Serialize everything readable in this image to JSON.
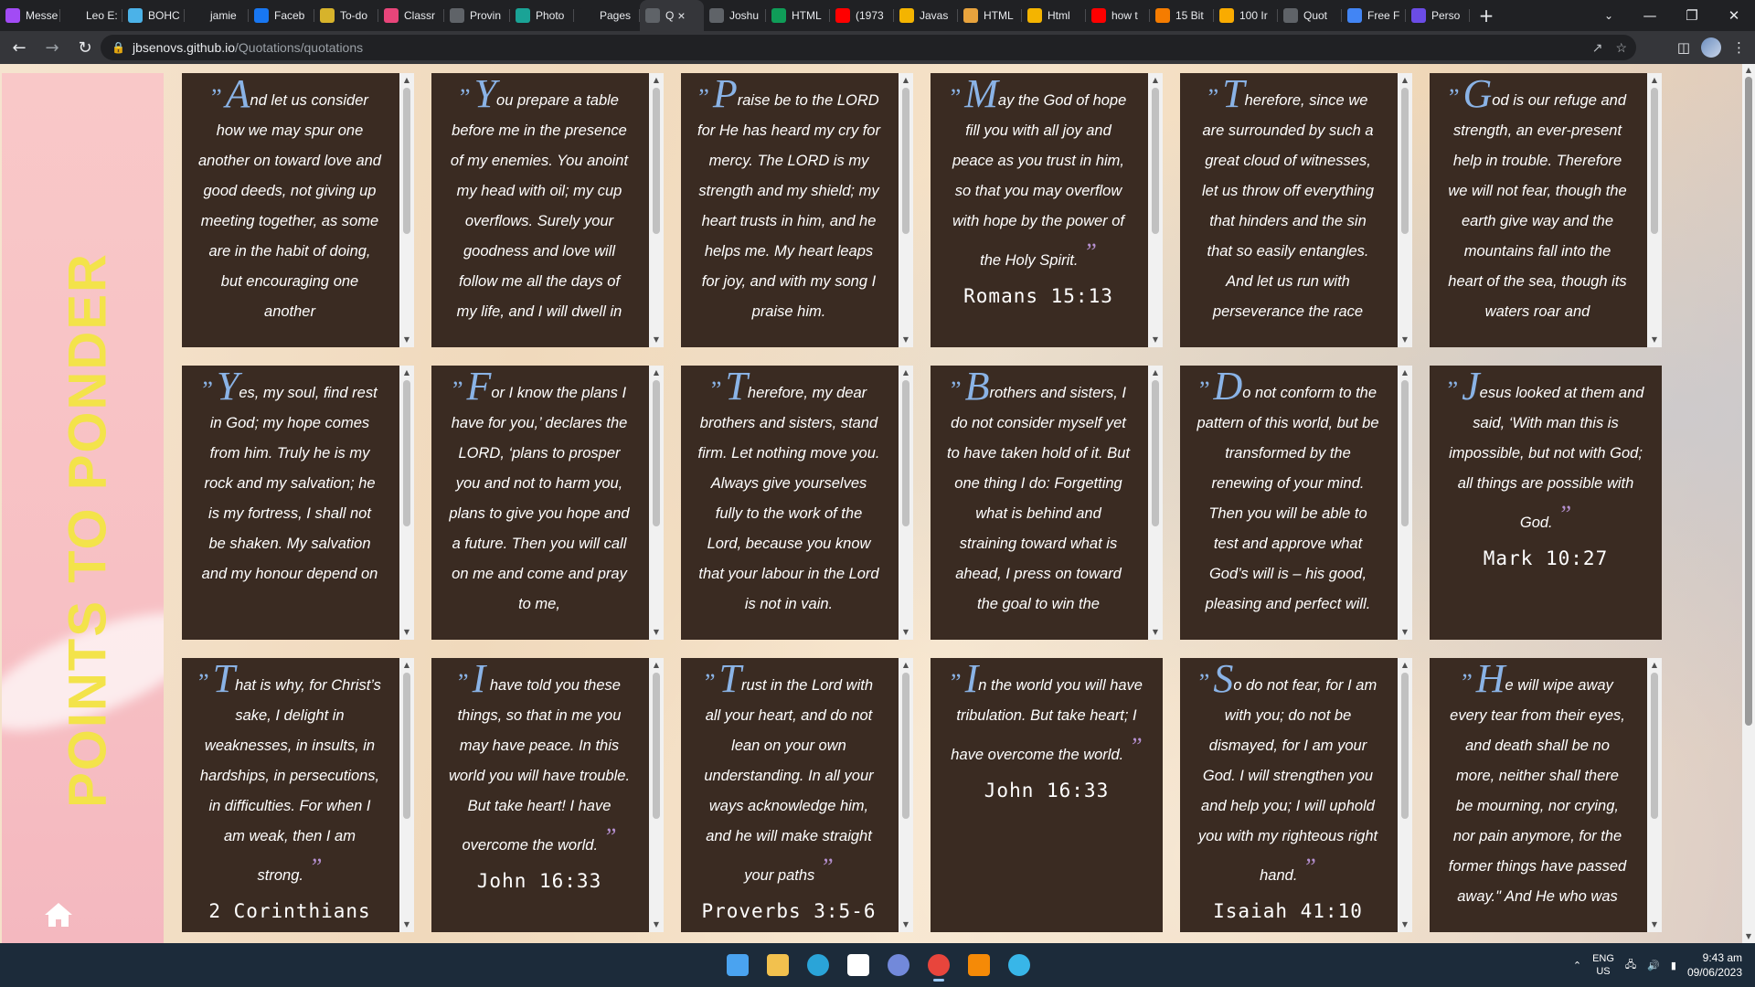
{
  "browser": {
    "tabs": [
      {
        "label": "Messe",
        "favicon": "messenger-icon",
        "color": "#a24bf5"
      },
      {
        "label": "Leo E:",
        "favicon": "leo-icon",
        "color": "#202124"
      },
      {
        "label": "BOHC",
        "favicon": "pencil-icon",
        "color": "#4bb2e8"
      },
      {
        "label": "jamie",
        "favicon": "github-icon",
        "color": "#202124"
      },
      {
        "label": "Faceb",
        "favicon": "facebook-icon",
        "color": "#1877f2"
      },
      {
        "label": "To-do",
        "favicon": "todo-icon",
        "color": "#d7b32b"
      },
      {
        "label": "Classr",
        "favicon": "classroom-icon",
        "color": "#e8457a"
      },
      {
        "label": "Provin",
        "favicon": "globe-icon",
        "color": "#5f6368"
      },
      {
        "label": "Photo",
        "favicon": "photo-icon",
        "color": "#1aa396"
      },
      {
        "label": "Pages",
        "favicon": "github-icon",
        "color": "#202124"
      },
      {
        "label": "Q",
        "favicon": "globe-icon",
        "color": "#5f6368",
        "active": true
      },
      {
        "label": "Joshu",
        "favicon": "globe-icon",
        "color": "#5f6368"
      },
      {
        "label": "HTML",
        "favicon": "html-icon",
        "color": "#0f9d58"
      },
      {
        "label": "(1973",
        "favicon": "youtube-icon",
        "color": "#ff0000"
      },
      {
        "label": "Javas",
        "favicon": "drive-icon",
        "color": "#f4b400"
      },
      {
        "label": "HTML",
        "favicon": "w3-icon",
        "color": "#e8a33d"
      },
      {
        "label": "Html",
        "favicon": "drive-icon",
        "color": "#f4b400"
      },
      {
        "label": "how t",
        "favicon": "youtube-icon",
        "color": "#ff0000"
      },
      {
        "label": "15 Bit",
        "favicon": "fire-icon",
        "color": "#f57c00"
      },
      {
        "label": "100 Ir",
        "favicon": "flag-icon",
        "color": "#f9ab00"
      },
      {
        "label": "Quot",
        "favicon": "globe-icon",
        "color": "#5f6368"
      },
      {
        "label": "Free F",
        "favicon": "shield-icon",
        "color": "#4285f4"
      },
      {
        "label": "Perso",
        "favicon": "person-icon",
        "color": "#6b4ce6"
      }
    ],
    "new_tab": "+",
    "url_host": "jbsenovs.github.io",
    "url_path": "/Quotations/quotations"
  },
  "page": {
    "sidebar_title": "POINTS TO PONDER",
    "home_icon": "home-icon",
    "colors": {
      "sidebar_title": "#f3e34a",
      "card_bg": "#3a2b22",
      "open_quote": "#8ab3e6",
      "close_quote": "#b590d0"
    },
    "cards": [
      {
        "first": "A",
        "rest": "nd let us consider how we may spur one another on toward love and good deeds, not giving up meeting together, as some are in the habit of doing, but encouraging one another",
        "ref": "",
        "scroll": true
      },
      {
        "first": "Y",
        "rest": "ou prepare a table before me in the presence of my enemies. You anoint my head with oil; my cup overflows. Surely your goodness and love will follow me all the days of my life, and I will dwell in",
        "ref": "",
        "scroll": true
      },
      {
        "first": "P",
        "rest": "raise be to the LORD for He has heard my cry for mercy. The LORD is my strength and my shield; my heart trusts in him, and he helps me. My heart leaps for joy, and with my song I praise him.",
        "ref": "",
        "scroll": true
      },
      {
        "first": "M",
        "rest": "ay the God of hope fill you with all joy and peace as you trust in him, so that you may overflow with hope by the power of the Holy Spirit.",
        "ref": "Romans 15:13",
        "scroll": true,
        "close": true
      },
      {
        "first": "T",
        "rest": "herefore, since we are surrounded by such a great cloud of witnesses, let us throw off everything that hinders and the sin that so easily entangles. And let us run with perseverance the race",
        "ref": "",
        "scroll": true
      },
      {
        "first": "G",
        "rest": "od is our refuge and strength, an ever-present help in trouble. Therefore we will not fear, though the earth give way and the mountains fall into the heart of the sea, though its waters roar and",
        "ref": "",
        "scroll": true
      },
      {
        "first": "Y",
        "rest": "es, my soul, find rest in God; my hope comes from him. Truly he is my rock and my salvation; he is my fortress, I shall not be shaken. My salvation and my honour depend on",
        "ref": "",
        "scroll": true
      },
      {
        "first": "F",
        "rest": "or I know the plans I have for you,’ declares the LORD, ‘plans to prosper you and not to harm you, plans to give you hope and a future. Then you will call on me and come and pray to me,",
        "ref": "",
        "scroll": true
      },
      {
        "first": "T",
        "rest": "herefore, my dear brothers and sisters, stand firm. Let nothing move you. Always give yourselves fully to the work of the Lord, because you know that your labour in the Lord is not in vain.",
        "ref": "",
        "scroll": true
      },
      {
        "first": "B",
        "rest": "rothers and sisters, I do not consider myself yet to have taken hold of it. But one thing I do: Forgetting what is behind and straining toward what is ahead, I press on toward the goal to win the",
        "ref": "",
        "scroll": true
      },
      {
        "first": "D",
        "rest": "o not conform to the pattern of this world, but be transformed by the renewing of your mind. Then you will be able to test and approve what God’s will is – his good, pleasing and perfect will.",
        "ref": "",
        "scroll": true
      },
      {
        "first": "J",
        "rest": "esus looked at them and said, ‘With man this is impossible, but not with God; all things are possible with God.",
        "ref": "Mark 10:27",
        "scroll": false,
        "close": true
      },
      {
        "first": "T",
        "rest": "hat is why, for Christ’s sake, I delight in weaknesses, in insults, in hardships, in persecutions, in difficulties. For when I am weak, then I am strong.",
        "ref": "2 Corinthians",
        "scroll": true,
        "close": true
      },
      {
        "first": "I",
        "rest": " have told you these things, so that in me you may have peace. In this world you will have trouble. But take heart! I have overcome the world.",
        "ref": "John 16:33",
        "scroll": true,
        "close": true
      },
      {
        "first": "T",
        "rest": "rust in the Lord with all your heart, and do not lean on your own understanding. In all your ways acknowledge him, and he will make straight your paths",
        "ref": "Proverbs 3:5-6",
        "scroll": true,
        "close": true
      },
      {
        "first": "I",
        "rest": "n the world you will have tribulation. But take heart; I have overcome the world.",
        "ref": "John 16:33",
        "scroll": false,
        "close": true
      },
      {
        "first": "S",
        "rest": "o do not fear, for I am with you; do not be dismayed, for I am your God. I will strengthen you and help you; I will uphold you with my righteous right hand.",
        "ref": "Isaiah 41:10",
        "scroll": true,
        "close": true
      },
      {
        "first": "H",
        "rest": "e will wipe away every tear from their eyes, and death shall be no more, neither shall there be mourning, nor crying, nor pain anymore, for the former things have passed away.\" And He who was",
        "ref": "",
        "scroll": true
      }
    ]
  },
  "taskbar": {
    "apps": [
      {
        "name": "start-icon",
        "color": "#4aa3f0"
      },
      {
        "name": "file-explorer-icon",
        "color": "#f2c14e"
      },
      {
        "name": "edge-icon",
        "color": "#2aa4d8"
      },
      {
        "name": "store-icon",
        "color": "#ffffff"
      },
      {
        "name": "discord-icon",
        "color": "#7289da"
      },
      {
        "name": "chrome-icon",
        "color": "#e8453c",
        "active": true
      },
      {
        "name": "sublime-icon",
        "color": "#f58a07"
      },
      {
        "name": "app-globe-icon",
        "color": "#38b6e8"
      }
    ],
    "lang_top": "ENG",
    "lang_bottom": "US",
    "time": "9:43 am",
    "date": "09/06/2023"
  }
}
